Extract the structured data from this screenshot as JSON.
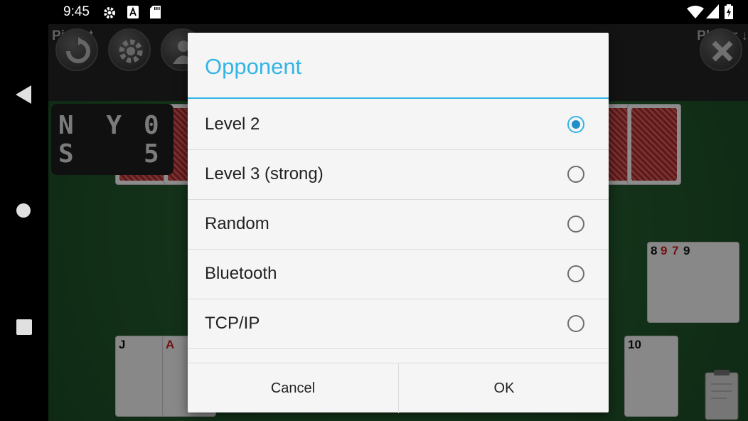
{
  "status_bar": {
    "time": "9:45"
  },
  "game": {
    "title": "Piquet",
    "player_label": "Player ↓",
    "scoreboard": {
      "row1_names": "N Y",
      "row1_score": "0",
      "row2_names": "S",
      "row2_score": "5"
    },
    "cards": {
      "right_group": [
        "8",
        "9",
        "7",
        "9"
      ],
      "bottom_left": [
        "J",
        "A"
      ],
      "bottom_right": "10"
    }
  },
  "dialog": {
    "title": "Opponent",
    "options": [
      {
        "label": "Level 2",
        "checked": true
      },
      {
        "label": "Level 3 (strong)",
        "checked": false
      },
      {
        "label": "Random",
        "checked": false
      },
      {
        "label": "Bluetooth",
        "checked": false
      },
      {
        "label": "TCP/IP",
        "checked": false
      }
    ],
    "cancel_label": "Cancel",
    "ok_label": "OK"
  },
  "colors": {
    "accent": "#33b5e5",
    "radio_selected": "#1e8fc7",
    "felt": "#235a2d"
  },
  "icons": [
    "settings-icon",
    "keyboard-a-icon",
    "sdcard-icon",
    "wifi-icon",
    "battery-icon",
    "back-icon",
    "home-icon",
    "recents-icon",
    "refresh-icon",
    "gear-icon",
    "person-icon",
    "close-icon",
    "clipboard-icon"
  ]
}
